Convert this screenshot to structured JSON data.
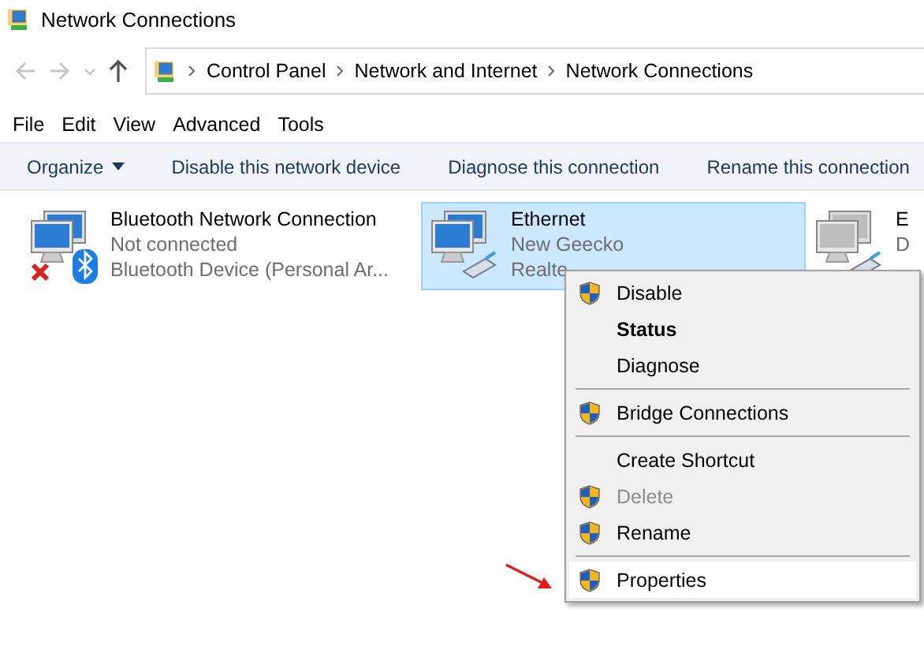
{
  "window": {
    "title": "Network Connections"
  },
  "address": {
    "crumbs": [
      "Control Panel",
      "Network and Internet",
      "Network Connections"
    ]
  },
  "menu_bar": [
    "File",
    "Edit",
    "View",
    "Advanced",
    "Tools"
  ],
  "command_bar": [
    {
      "label": "Organize",
      "dropdown": true
    },
    {
      "label": "Disable this network device",
      "dropdown": false
    },
    {
      "label": "Diagnose this connection",
      "dropdown": false
    },
    {
      "label": "Rename this connection",
      "dropdown": false
    }
  ],
  "connections": [
    {
      "name": "Bluetooth Network Connection",
      "status": "Not connected",
      "device": "Bluetooth Device (Personal Ar...",
      "selected": false,
      "kind": "bluetooth",
      "connected": false
    },
    {
      "name": "Ethernet",
      "status": "New Geecko",
      "device": "Realte",
      "selected": true,
      "kind": "ethernet",
      "connected": true
    },
    {
      "name": "E",
      "status": "D",
      "selected": false,
      "kind": "ethernet",
      "connected": false
    }
  ],
  "context_menu": [
    {
      "kind": "item",
      "label": "Disable",
      "shield": true,
      "bold": false,
      "disabled": false,
      "selected": false
    },
    {
      "kind": "item",
      "label": "Status",
      "shield": false,
      "bold": true,
      "disabled": false,
      "selected": false
    },
    {
      "kind": "item",
      "label": "Diagnose",
      "shield": false,
      "bold": false,
      "disabled": false,
      "selected": false
    },
    {
      "kind": "separator"
    },
    {
      "kind": "item",
      "label": "Bridge Connections",
      "shield": true,
      "bold": false,
      "disabled": false,
      "selected": false
    },
    {
      "kind": "separator"
    },
    {
      "kind": "item",
      "label": "Create Shortcut",
      "shield": false,
      "bold": false,
      "disabled": false,
      "selected": false
    },
    {
      "kind": "item",
      "label": "Delete",
      "shield": true,
      "bold": false,
      "disabled": true,
      "selected": false
    },
    {
      "kind": "item",
      "label": "Rename",
      "shield": true,
      "bold": false,
      "disabled": false,
      "selected": false
    },
    {
      "kind": "separator"
    },
    {
      "kind": "item",
      "label": "Properties",
      "shield": true,
      "bold": false,
      "disabled": false,
      "selected": true
    }
  ]
}
